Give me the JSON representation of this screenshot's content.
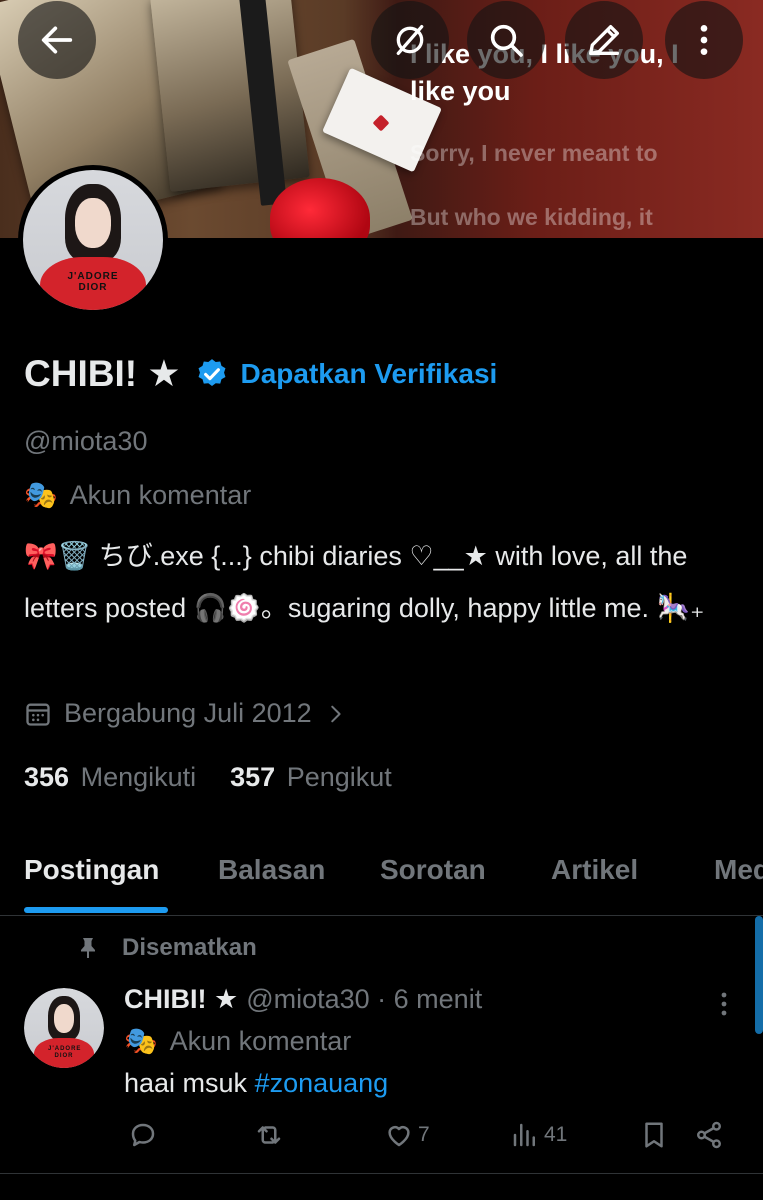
{
  "banner": {
    "lines": [
      "I like you, I like you, I",
      "like you"
    ],
    "faded_lines": [
      "Sorry, I never meant to",
      "But who we kidding, it"
    ]
  },
  "nav": {
    "back_icon": "arrow-left-icon",
    "grok_icon": "grok-icon",
    "search_icon": "search-icon",
    "edit_icon": "pencil-icon",
    "more_icon": "more-vertical-icon"
  },
  "profile": {
    "name": "CHIBI! ★",
    "get_verified": "Dapatkan Verifikasi",
    "handle": "@miota30",
    "label_emoji": "🎭",
    "label": "Akun komentar",
    "bio": "🎀🗑️  ちび.exe  {...}  chibi diaries  ♡__★  with love, all the letters posted  🎧🍥。sugaring dolly, happy little me. 🎠₊",
    "joined": "Bergabung Juli 2012",
    "following_count": "356",
    "following_label": "Mengikuti",
    "followers_count": "357",
    "followers_label": "Pengikut",
    "avatar_shirt_text": "J'ADORE DIOR"
  },
  "tabs": [
    "Postingan",
    "Balasan",
    "Sorotan",
    "Artikel",
    "Media"
  ],
  "post": {
    "pinned_label": "Disematkan",
    "name": "CHIBI! ★",
    "meta": "@miota30 · 6 menit",
    "label_emoji": "🎭",
    "label": "Akun komentar",
    "text": "haai msuk ",
    "hashtag": "#zonauang",
    "likes": "7",
    "views": "41"
  },
  "colors": {
    "accent": "#1d9bf0",
    "background": "#000000",
    "text_primary": "#e7e9ea",
    "text_secondary": "#71767b"
  }
}
